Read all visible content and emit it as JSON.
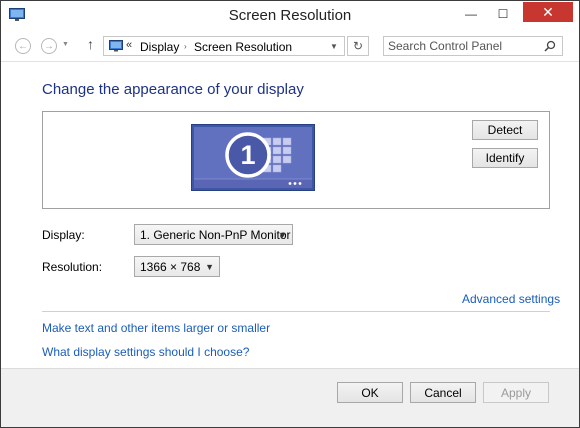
{
  "window": {
    "title": "Screen Resolution",
    "icon": "monitor-icon",
    "controls": {
      "minimize": "—",
      "maximize": "☐",
      "close": "✕"
    }
  },
  "nav": {
    "back_icon": "arrow-left-icon",
    "forward_icon": "arrow-right-icon",
    "up_icon": "arrow-up-icon",
    "address_prefix": "«",
    "breadcrumbs": [
      "Display",
      "Screen Resolution"
    ],
    "search_placeholder": "Search Control Panel"
  },
  "main": {
    "heading": "Change the appearance of your display",
    "monitor_number": "1",
    "buttons": {
      "detect": "Detect",
      "identify": "Identify"
    },
    "display": {
      "label": "Display:",
      "value": "1. Generic Non-PnP Monitor"
    },
    "resolution": {
      "label": "Resolution:",
      "value": "1366 × 768"
    },
    "links": {
      "advanced": "Advanced settings",
      "text_size": "Make text and other items larger or smaller",
      "which_settings": "What display settings should I choose?"
    }
  },
  "footer": {
    "ok": "OK",
    "cancel": "Cancel",
    "apply": "Apply"
  },
  "colors": {
    "heading": "#1e3287",
    "link": "#1a5dbb",
    "close_button": "#c7372f",
    "monitor_blue": "#6270c0"
  }
}
